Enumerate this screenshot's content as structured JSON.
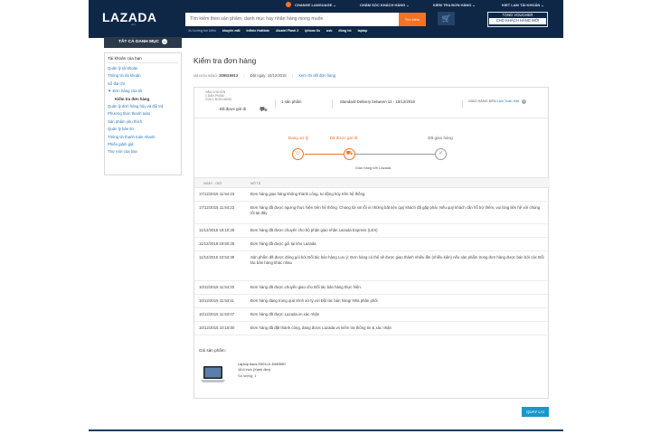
{
  "header": {
    "utility_links": [
      "CHANGE LANGUAGE",
      "CHĂM SÓC KHÁCH HÀNG",
      "KIỂM TRA ĐƠN HÀNG",
      "KIET LAM TÀI KHOẢN"
    ],
    "logo_text": "LAZADA",
    "logo_sub": "viet",
    "search_placeholder": "Tìm kiếm theo sản phẩm, danh mục hay nhãn hàng mong muốn",
    "search_button": "Tìm kiếm",
    "voucher_line1": "TẶNG VOUCHER",
    "voucher_line2": "CHO KHÁCH HÀNG MỚI",
    "suggest_label": "Xu hướng tìm kiếm",
    "suggest_terms": [
      "khuyến mãi",
      "Infinix HotNote",
      "Alcatel Flash 2",
      "iphone 6s",
      "usb",
      "đồng hồ",
      "laptop"
    ]
  },
  "sidebar": {
    "category_button": "TẤT CẢ DANH MỤC",
    "title": "Tài khoản của bạn",
    "items": [
      {
        "label": "Quản lý tài khoản"
      },
      {
        "label": "Thông tin tài khoản"
      },
      {
        "label": "Sổ địa chỉ"
      },
      {
        "label": "▼ Đơn hàng của tôi"
      },
      {
        "label": "Kiểm tra đơn hàng"
      },
      {
        "label": "Quản lý đơn hàng hủy và đổi trả"
      },
      {
        "label": "Phương thức thanh toán"
      },
      {
        "label": "Sản phẩm yêu thích"
      },
      {
        "label": "Quản lý bản tin"
      },
      {
        "label": "Thông tin thanh toán nhanh"
      },
      {
        "label": "Phiếu giảm giá"
      },
      {
        "label": "Thư mời của bạn"
      }
    ]
  },
  "main": {
    "title": "Kiểm tra đơn hàng",
    "order_number_label": "MÃ ĐƠN HÀNG:",
    "order_number": "309519813",
    "order_date": "Đặt ngày: 10/12/2015",
    "detail_link": "Xem chi tiết đơn hàng",
    "shipment_label_1": "VẬN CHUYỂN",
    "shipment_label_2": "1 SẢN PHẨM",
    "shipment_label_3": "CỦA 1 ĐƠN HÀNG",
    "shipment_status": "Đã được gửi đi",
    "qty": "1 sản phẩm",
    "delivery": "Standard Delivery between 12 - 15/12/2015",
    "receiver_label": "GIAO HÀNG ĐẾN",
    "receiver_name": "Lâm Tuấn Kiệt",
    "steps": [
      "Đang xử lý",
      "Đã được gửi đi",
      "Đã giao hàng"
    ],
    "carrier_note": "Giao hàng bởi Lazada",
    "table_headers": {
      "date": "NGÀY - GIỜ",
      "desc": "MÔ TẢ"
    },
    "events": [
      {
        "date": "17/12/2015 11:54:23",
        "desc": "Đơn hàng giao hàng không thành công, tư động hủy trên hệ thống"
      },
      {
        "date": "17/12/2015 11:54:23",
        "desc": "Đơn hàng đã được ngưng thực hiện trên hệ thống. Chúng tôi xin lỗi vì những bất tiện quý khách đã gặp phải. Nếu quý khách cần hỗ trợ thêm, vui lòng liên hệ với chúng tôi tại đây"
      },
      {
        "date": "11/12/2015 19:10:29",
        "desc": "Đơn hàng đã được chuyển cho bộ phận giao nhận Lazada Express (LEX)"
      },
      {
        "date": "11/12/2015 18:50:28",
        "desc": "Đơn hàng đã được gói tại kho Lazada"
      },
      {
        "date": "11/12/2015 10:53:39",
        "desc": "Sản phẩm đã được đóng gói bởi Đối tác bán hàng Lưu ý: Đơn hàng có thể sẽ được giao thành nhiều lần (nhiều kiện) nếu sản phẩm trong đơn hàng được bán bởi các Đối tác bán hàng khác nhau"
      },
      {
        "date": "10/12/2015 11:54:20",
        "desc": "Đơn hàng đã được chuyển giao cho Đối tác bán hàng thực hiện."
      },
      {
        "date": "10/12/2015 11:53:11",
        "desc": "Đơn hàng đang trong quá trình xử lý với Đối tác bán hàng/ Nhà phân phối"
      },
      {
        "date": "10/12/2015 11:53:07",
        "desc": "Đơn hàng đã được Lazada.vn xác nhận"
      },
      {
        "date": "10/12/2015 10:15:00",
        "desc": "Đơn hàng đã đặt thành công, đang được Lazada.vn kiểm tra thông tin & xác nhận"
      }
    ],
    "package_title": "Gói sản phẩm:",
    "product_name": "Laptop Asus K501LX-DM059D",
    "product_spec": "15.6 inch (Xanh đen)",
    "product_qty": "Số lượng: 1",
    "back_button": "QUAY LẠI"
  },
  "colors": {
    "header_bg": "#0f2747",
    "accent": "#f57224",
    "link": "#2a77b9",
    "back_button": "#1a98c8"
  }
}
